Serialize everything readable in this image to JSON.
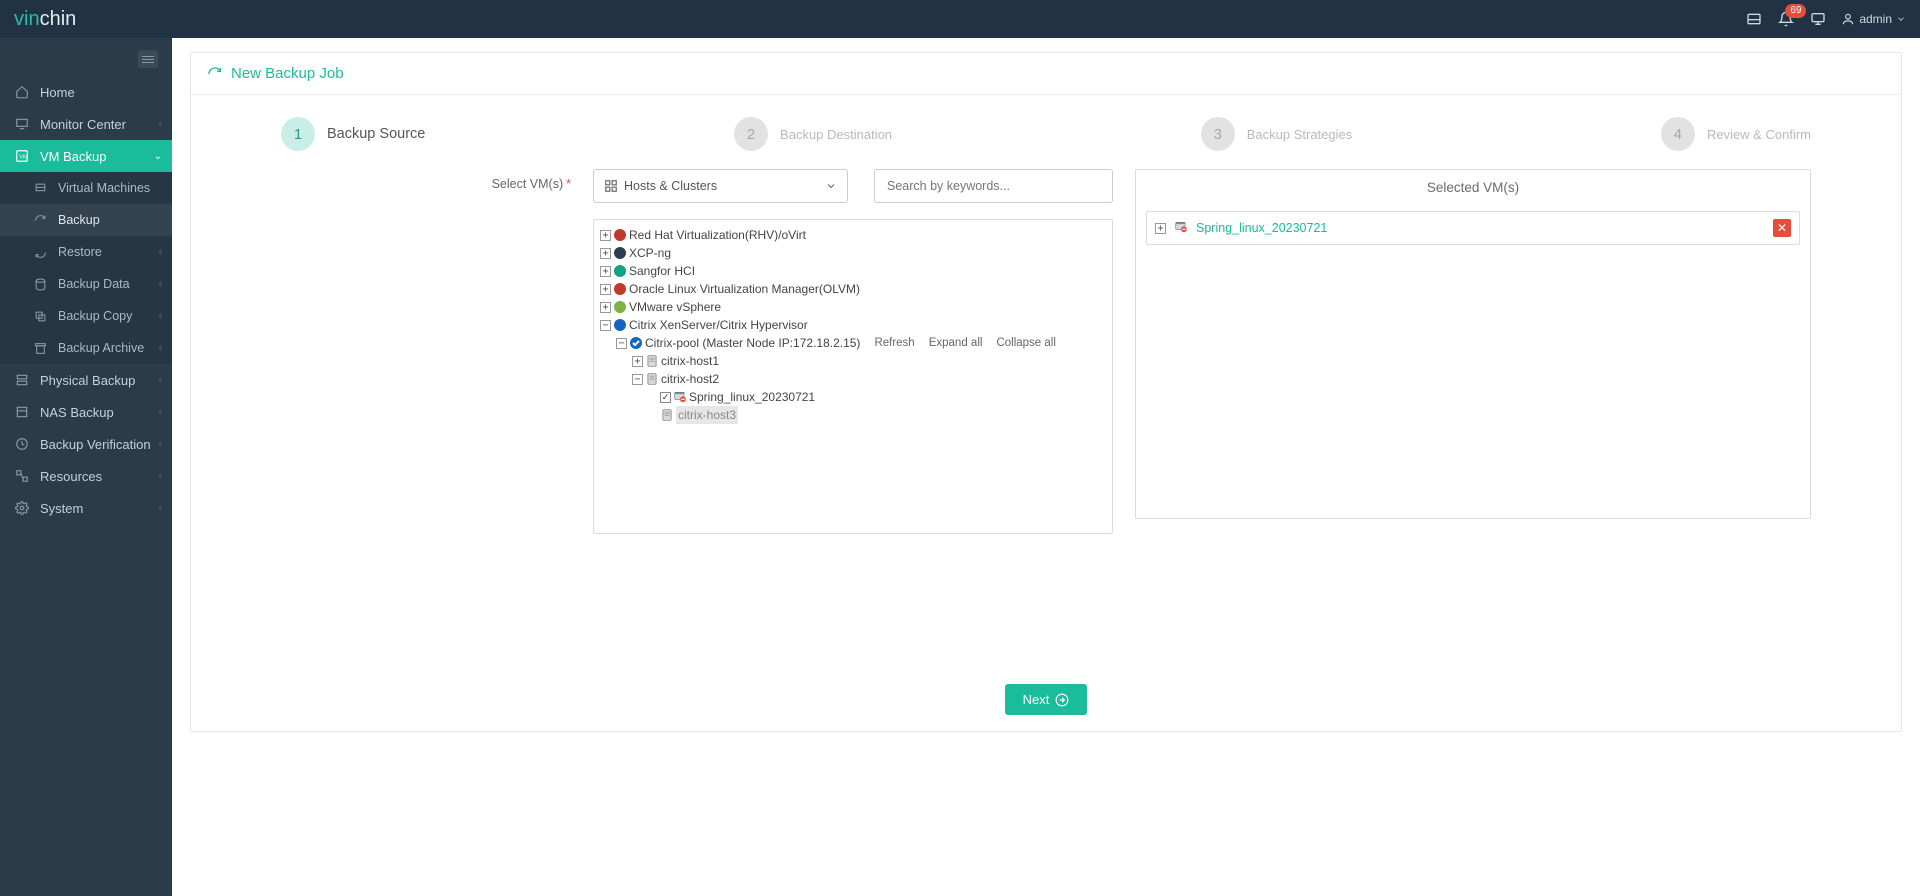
{
  "brand": {
    "part1": "vin",
    "part2": "chin"
  },
  "topbar": {
    "badge": "69",
    "user": "admin"
  },
  "sidebar": {
    "items": [
      {
        "id": "home",
        "label": "Home",
        "chev": false
      },
      {
        "id": "monitor",
        "label": "Monitor Center",
        "chev": true
      },
      {
        "id": "vmbackup",
        "label": "VM Backup",
        "chev": true,
        "active": true,
        "open": true
      },
      {
        "id": "physical",
        "label": "Physical Backup",
        "chev": true
      },
      {
        "id": "nas",
        "label": "NAS Backup",
        "chev": true
      },
      {
        "id": "verify",
        "label": "Backup Verification",
        "chev": true
      },
      {
        "id": "resources",
        "label": "Resources",
        "chev": true
      },
      {
        "id": "system",
        "label": "System",
        "chev": true
      }
    ],
    "sub": [
      {
        "id": "vms",
        "label": "Virtual Machines"
      },
      {
        "id": "backup",
        "label": "Backup",
        "sel": true
      },
      {
        "id": "restore",
        "label": "Restore",
        "chev": true
      },
      {
        "id": "bdata",
        "label": "Backup Data",
        "chev": true
      },
      {
        "id": "bcopy",
        "label": "Backup Copy",
        "chev": true
      },
      {
        "id": "barchive",
        "label": "Backup Archive",
        "chev": true
      }
    ]
  },
  "page": {
    "title": "New Backup Job",
    "steps": [
      {
        "n": "1",
        "label": "Backup Source",
        "active": true
      },
      {
        "n": "2",
        "label": "Backup Destination"
      },
      {
        "n": "3",
        "label": "Backup Strategies"
      },
      {
        "n": "4",
        "label": "Review & Confirm"
      }
    ],
    "select_label": "Select VM(s)",
    "dropdown": {
      "label": "Hosts & Clusters"
    },
    "search_placeholder": "Search by keywords...",
    "tree": {
      "nodes": [
        {
          "label": "Red Hat Virtualization(RHV)/oVirt",
          "color": "#c0392b"
        },
        {
          "label": "XCP-ng",
          "color": "#2c3e50"
        },
        {
          "label": "Sangfor HCI",
          "color": "#16a085"
        },
        {
          "label": "Oracle Linux Virtualization Manager(OLVM)",
          "color": "#c0392b"
        },
        {
          "label": "VMware vSphere",
          "color": "#7cb342"
        },
        {
          "label": "Citrix XenServer/Citrix Hypervisor",
          "color": "#1565c0",
          "open": true
        }
      ],
      "pool": {
        "label": "Citrix-pool (Master Node IP:172.18.2.15)"
      },
      "actions": {
        "refresh": "Refresh",
        "expand": "Expand all",
        "collapse": "Collapse all"
      },
      "hosts": [
        {
          "label": "citrix-host1",
          "open": false
        },
        {
          "label": "citrix-host2",
          "open": true
        },
        {
          "label": "citrix-host3",
          "greyed": true
        }
      ],
      "vm": {
        "label": "Spring_linux_20230721",
        "checked": true
      }
    },
    "selected": {
      "title": "Selected VM(s)",
      "items": [
        {
          "label": "Spring_linux_20230721"
        }
      ]
    },
    "next": "Next"
  }
}
